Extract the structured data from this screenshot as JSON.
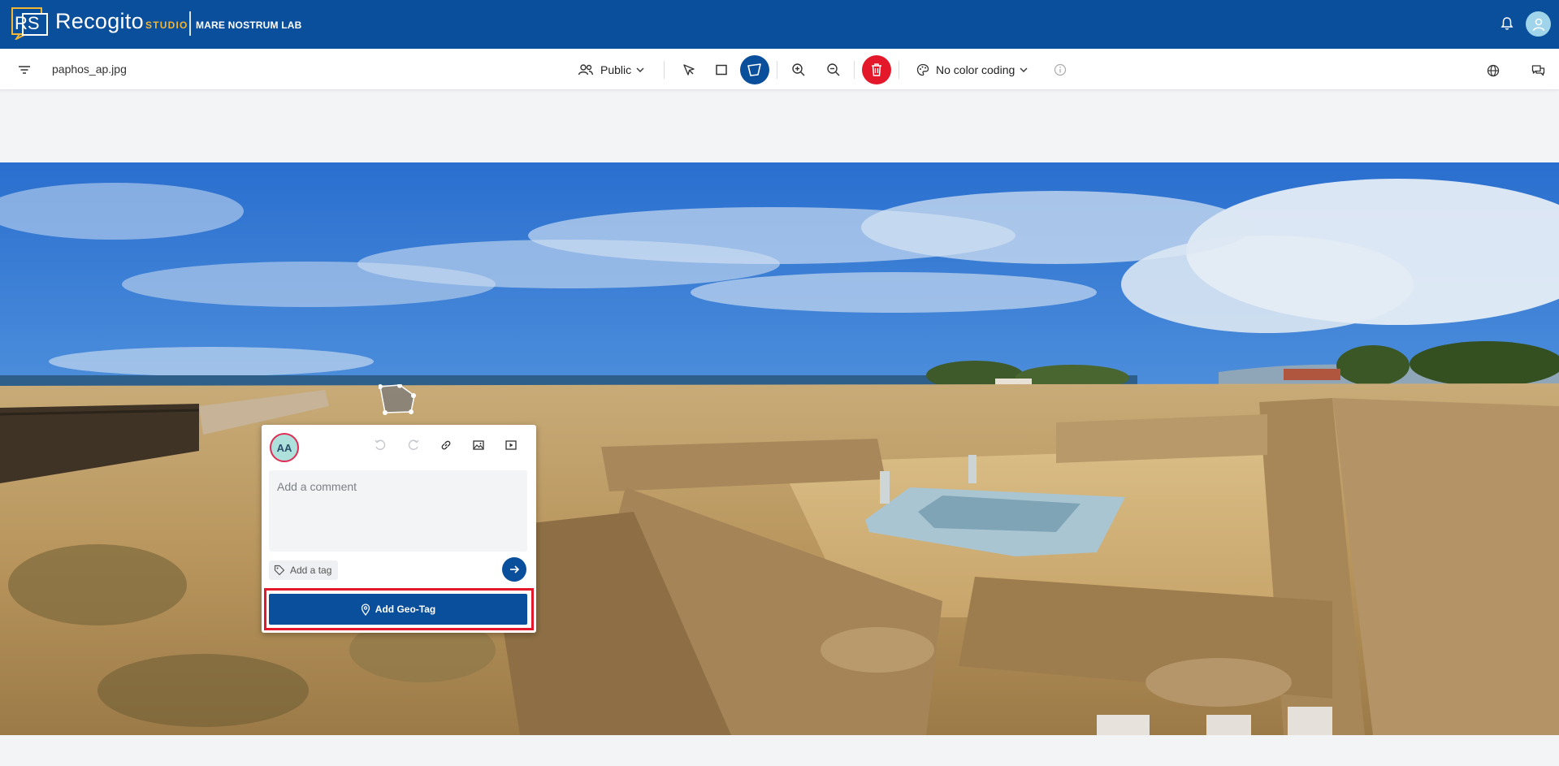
{
  "app": {
    "brand": "Recogito",
    "brand_suffix": "STUDIO",
    "organization": "MARE NOSTRUM LAB",
    "logo_text": "RS"
  },
  "toolbar": {
    "filename": "paphos_ap.jpg",
    "visibility_label": "Public",
    "color_coding_label": "No color coding",
    "active_tool": "polygon-tool"
  },
  "editor": {
    "user_initials": "AA",
    "comment_placeholder": "Add a comment",
    "tag_label": "Add a tag",
    "geotag_label": "Add Geo-Tag"
  },
  "colors": {
    "primary": "#0a4f9c",
    "danger": "#e3192b",
    "accent": "#f2b633"
  }
}
